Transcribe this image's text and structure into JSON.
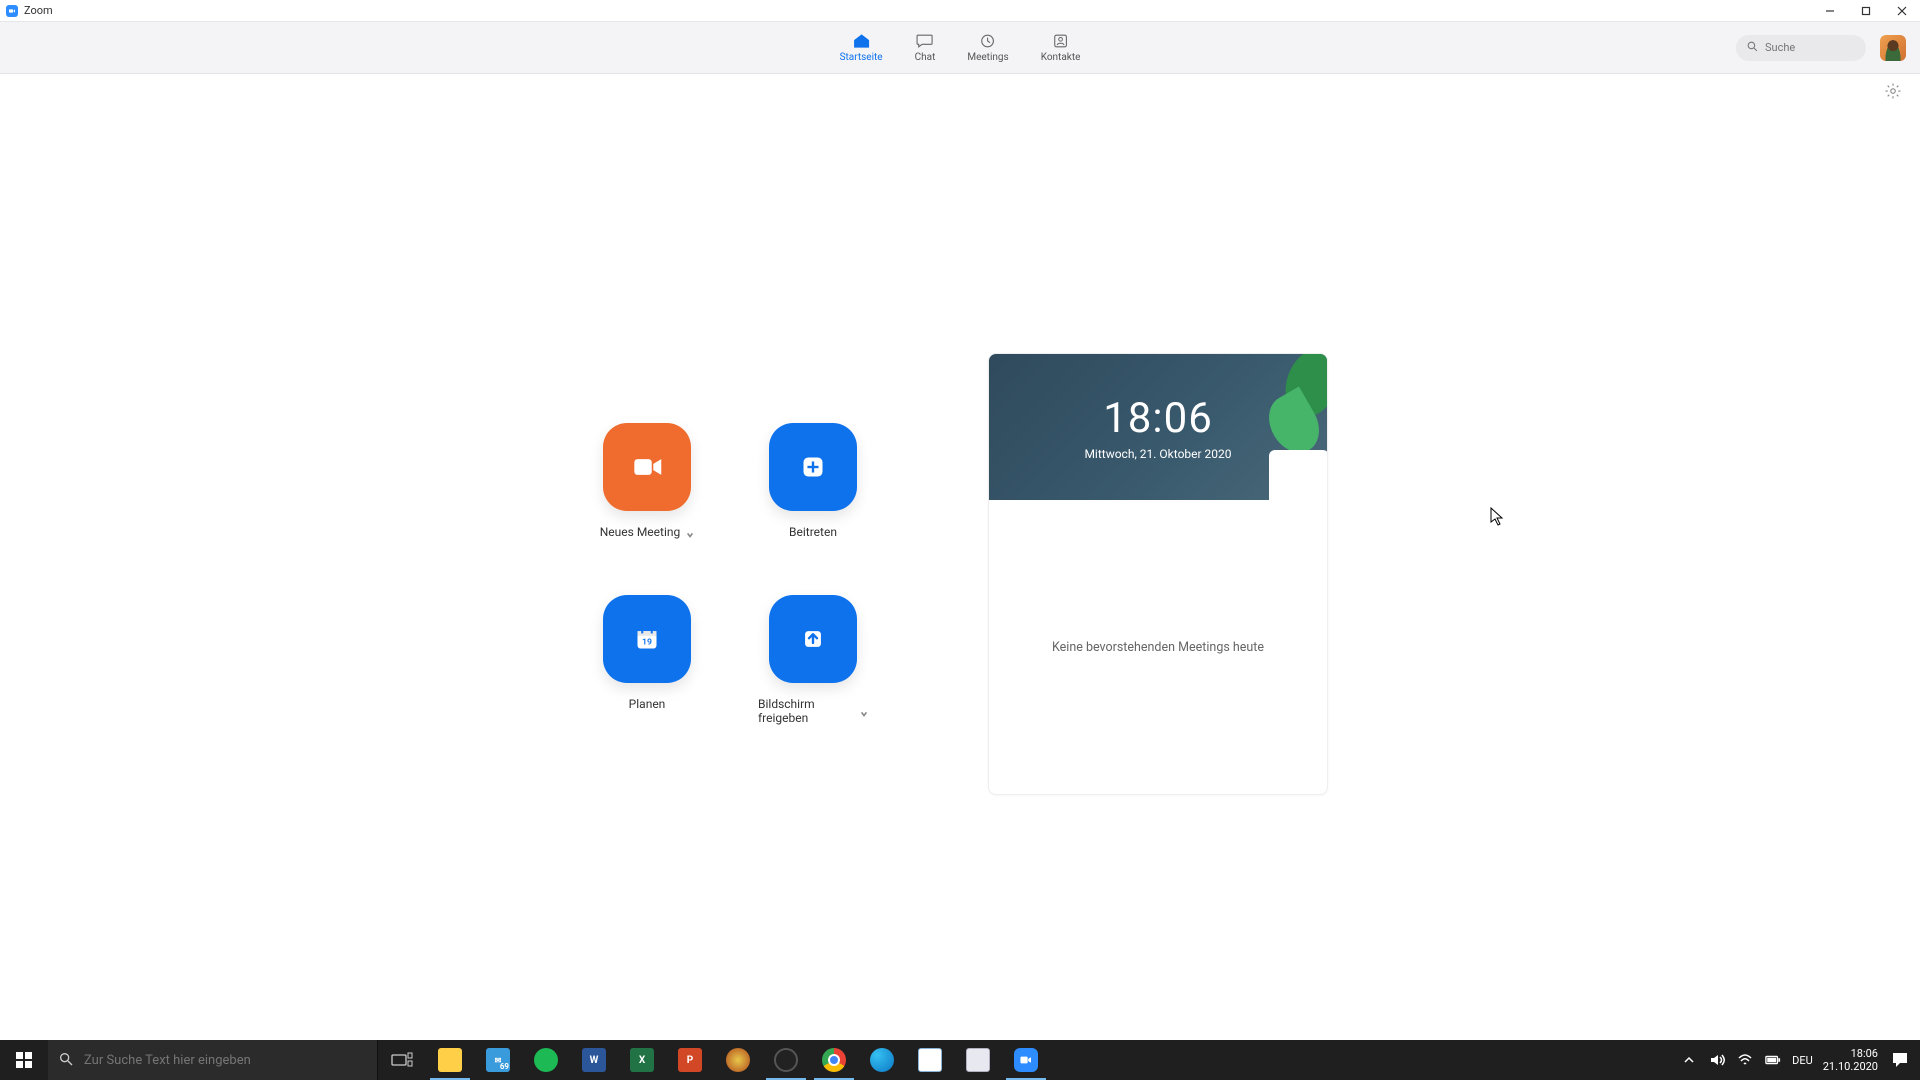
{
  "titlebar": {
    "app_name": "Zoom"
  },
  "nav": {
    "tabs": [
      {
        "label": "Startseite"
      },
      {
        "label": "Chat"
      },
      {
        "label": "Meetings"
      },
      {
        "label": "Kontakte"
      }
    ],
    "search_placeholder": "Suche"
  },
  "actions": {
    "new_meeting": "Neues Meeting",
    "join": "Beitreten",
    "schedule": "Planen",
    "schedule_day": "19",
    "share": "Bildschirm freigeben"
  },
  "panel": {
    "time": "18:06",
    "date": "Mittwoch, 21. Oktober 2020",
    "empty_text": "Keine bevorstehenden Meetings heute"
  },
  "taskbar": {
    "search_placeholder": "Zur Suche Text hier eingeben",
    "lang": "DEU",
    "time": "18:06",
    "date": "21.10.2020",
    "mail_badge": "69"
  }
}
